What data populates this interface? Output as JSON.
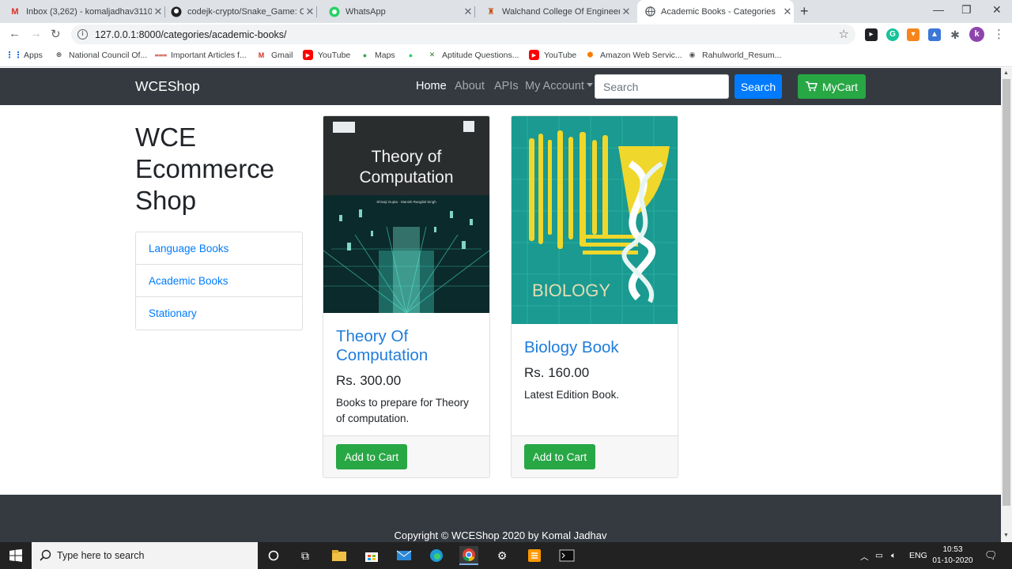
{
  "browser": {
    "tabs": [
      {
        "title": "Inbox (3,262) - komaljadhav3110",
        "icon": "gmail-icon"
      },
      {
        "title": "codejk-crypto/Snake_Game: Crea",
        "icon": "github-icon"
      },
      {
        "title": "WhatsApp",
        "icon": "whatsapp-icon"
      },
      {
        "title": "Walchand College Of Engineering",
        "icon": "college-icon"
      },
      {
        "title": "Academic Books - Categories",
        "icon": "globe-icon",
        "active": true
      }
    ],
    "url": "127.0.0.1:8000/categories/academic-books/",
    "bookmarks": [
      "Apps",
      "National Council Of...",
      "Important Articles f...",
      "Gmail",
      "YouTube",
      "Maps",
      "",
      "Aptitude Questions...",
      "YouTube",
      "Amazon Web Servic...",
      "Rahulworld_Resum..."
    ],
    "profile_initial": "k"
  },
  "site": {
    "brand": "WCEShop",
    "nav": {
      "home": "Home",
      "about": "About",
      "apis": "APIs",
      "account": "My Account"
    },
    "search_placeholder": "Search",
    "search_button": "Search",
    "cart_button": "MyCart",
    "heading": "WCE Ecommerce Shop",
    "categories": [
      "Language Books",
      "Academic Books",
      "Stationary"
    ],
    "products": [
      {
        "title": "Theory Of Computation",
        "price": "Rs. 300.00",
        "description": "Books to prepare for Theory of computation.",
        "button": "Add to Cart",
        "cover": {
          "title_line1": "Theory of",
          "title_line2": "Computation",
          "authors": "Shivaji Gupta · Manish Rangilal Singh"
        }
      },
      {
        "title": "Biology Book",
        "price": "Rs. 160.00",
        "description": "Latest Edition Book.",
        "button": "Add to Cart",
        "cover": {
          "title": "BIOLOGY"
        }
      }
    ],
    "footer": "Copyright © WCEShop 2020 by Komal Jadhav"
  },
  "taskbar": {
    "search_placeholder": "Type here to search",
    "language": "ENG",
    "time": "10:53",
    "date": "01-10-2020"
  },
  "colors": {
    "navbar": "#343a40",
    "primary": "#007bff",
    "success": "#28a745",
    "link": "#007bff"
  }
}
